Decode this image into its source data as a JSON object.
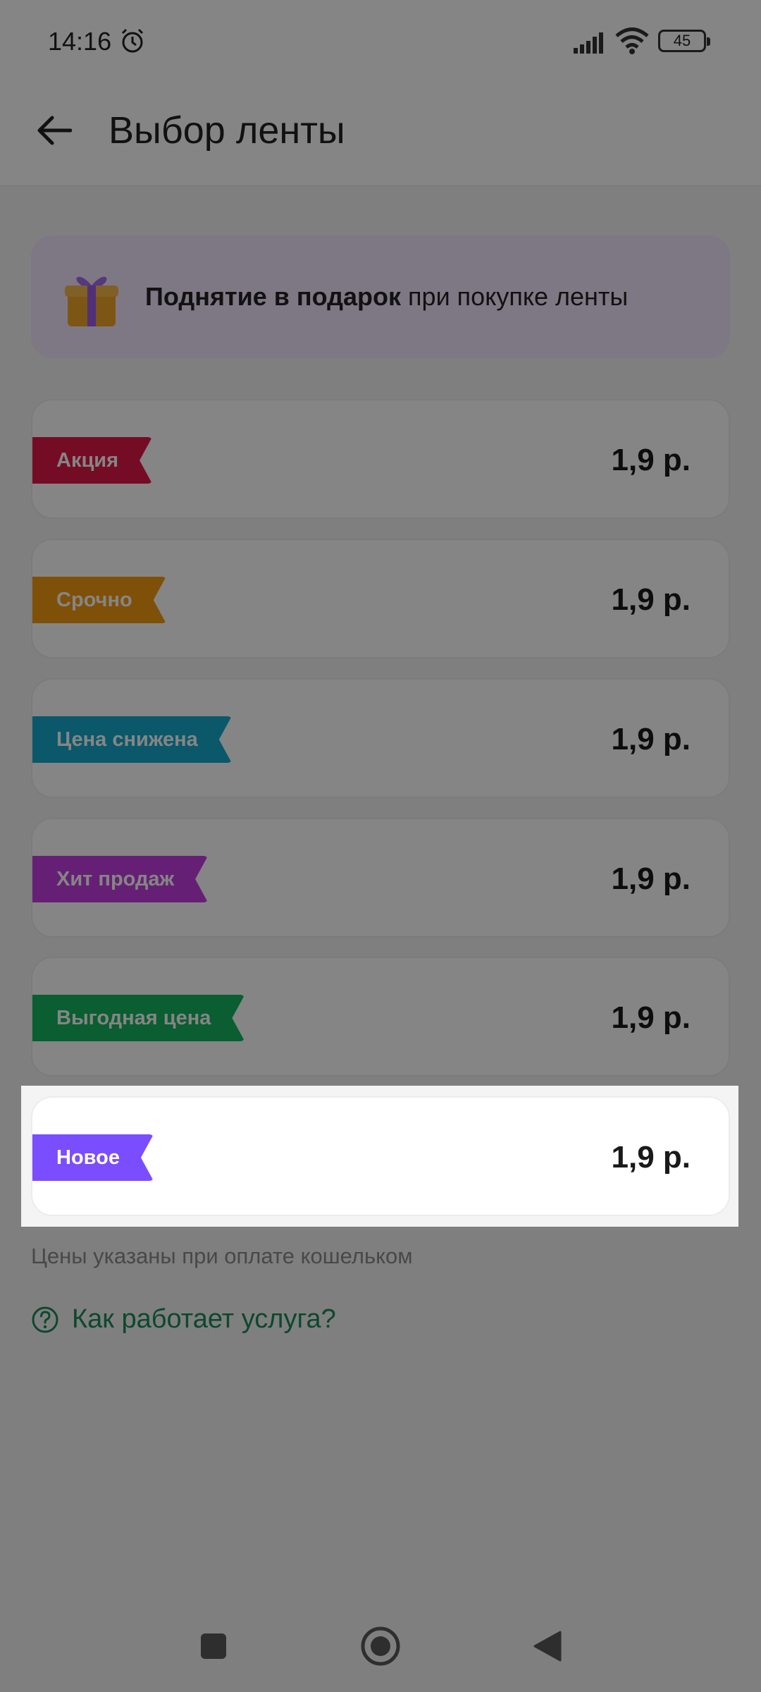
{
  "status": {
    "time": "14:16",
    "battery": "45"
  },
  "header": {
    "title": "Выбор ленты"
  },
  "promo": {
    "bold": "Поднятие в подарок",
    "rest": " при покупке ленты"
  },
  "ribbons": [
    {
      "label": "Акция",
      "price": "1,9 р.",
      "color": "#e0174a"
    },
    {
      "label": "Срочно",
      "price": "1,9 р.",
      "color": "#f39a10"
    },
    {
      "label": "Цена снижена",
      "price": "1,9 р.",
      "color": "#14aacb"
    },
    {
      "label": "Хит продаж",
      "price": "1,9 р.",
      "color": "#c23fe0"
    },
    {
      "label": "Выгодная цена",
      "price": "1,9 р.",
      "color": "#14b45e"
    },
    {
      "label": "Новое",
      "price": "1,9 р.",
      "color": "#7a4dff"
    }
  ],
  "note": "Цены указаны при оплате кошельком",
  "how_link": "Как работает услуга?",
  "colors": {
    "accent_green": "#1a8a57"
  }
}
